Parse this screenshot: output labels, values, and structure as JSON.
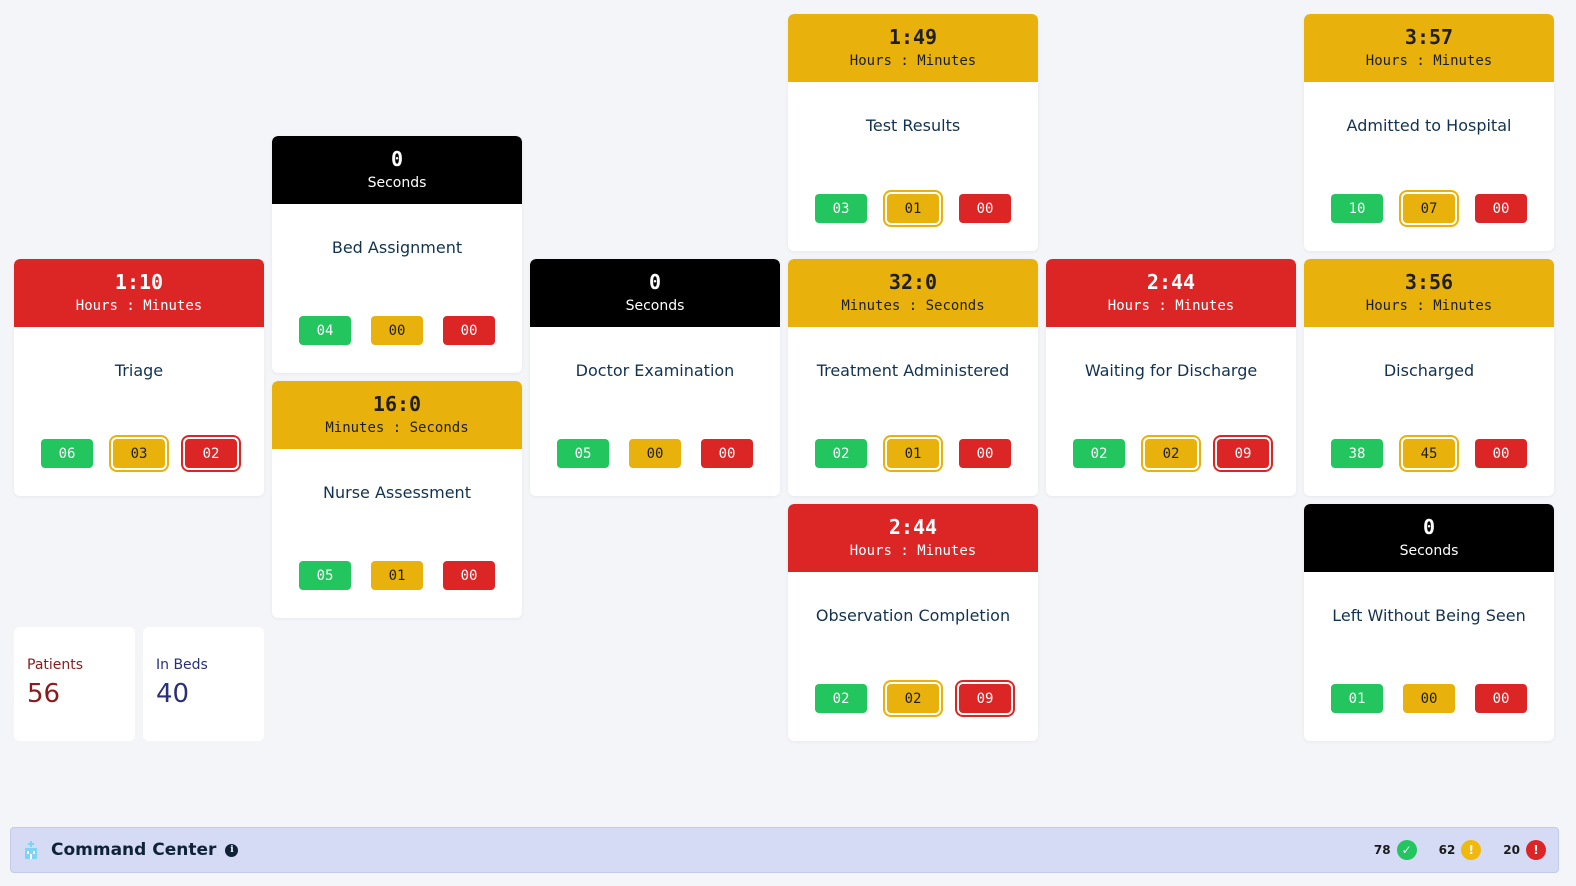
{
  "cards": [
    {
      "id": "triage",
      "title": "Triage",
      "timer": {
        "value": "1:10",
        "unit": "Hours : Minutes",
        "color": "red"
      },
      "badges": [
        {
          "value": "06",
          "color": "green"
        },
        {
          "value": "03",
          "color": "yellow",
          "ring": true
        },
        {
          "value": "02",
          "color": "red",
          "ring": true
        }
      ]
    },
    {
      "id": "bed-assignment",
      "title": "Bed Assignment",
      "timer": {
        "value": "0",
        "unit": "Seconds",
        "color": "black"
      },
      "badges": [
        {
          "value": "04",
          "color": "green"
        },
        {
          "value": "00",
          "color": "yellow"
        },
        {
          "value": "00",
          "color": "red"
        }
      ]
    },
    {
      "id": "nurse-assessment",
      "title": "Nurse Assessment",
      "timer": {
        "value": "16:0",
        "unit": "Minutes : Seconds",
        "color": "yellow"
      },
      "badges": [
        {
          "value": "05",
          "color": "green"
        },
        {
          "value": "01",
          "color": "yellow"
        },
        {
          "value": "00",
          "color": "red"
        }
      ]
    },
    {
      "id": "doctor-examination",
      "title": "Doctor Examination",
      "timer": {
        "value": "0",
        "unit": "Seconds",
        "color": "black"
      },
      "badges": [
        {
          "value": "05",
          "color": "green"
        },
        {
          "value": "00",
          "color": "yellow"
        },
        {
          "value": "00",
          "color": "red"
        }
      ]
    },
    {
      "id": "test-results",
      "title": "Test Results",
      "timer": {
        "value": "1:49",
        "unit": "Hours : Minutes",
        "color": "yellow"
      },
      "badges": [
        {
          "value": "03",
          "color": "green"
        },
        {
          "value": "01",
          "color": "yellow",
          "ring": true
        },
        {
          "value": "00",
          "color": "red"
        }
      ]
    },
    {
      "id": "treatment-administered",
      "title": "Treatment Administered",
      "timer": {
        "value": "32:0",
        "unit": "Minutes : Seconds",
        "color": "yellow"
      },
      "badges": [
        {
          "value": "02",
          "color": "green"
        },
        {
          "value": "01",
          "color": "yellow",
          "ring": true
        },
        {
          "value": "00",
          "color": "red"
        }
      ]
    },
    {
      "id": "observation-completion",
      "title": "Observation Completion",
      "timer": {
        "value": "2:44",
        "unit": "Hours : Minutes",
        "color": "red"
      },
      "badges": [
        {
          "value": "02",
          "color": "green"
        },
        {
          "value": "02",
          "color": "yellow",
          "ring": true
        },
        {
          "value": "09",
          "color": "red",
          "ring": true
        }
      ]
    },
    {
      "id": "waiting-for-discharge",
      "title": "Waiting for Discharge",
      "timer": {
        "value": "2:44",
        "unit": "Hours : Minutes",
        "color": "red"
      },
      "badges": [
        {
          "value": "02",
          "color": "green"
        },
        {
          "value": "02",
          "color": "yellow",
          "ring": true
        },
        {
          "value": "09",
          "color": "red",
          "ring": true
        }
      ]
    },
    {
      "id": "admitted-to-hospital",
      "title": "Admitted to Hospital",
      "timer": {
        "value": "3:57",
        "unit": "Hours : Minutes",
        "color": "yellow"
      },
      "badges": [
        {
          "value": "10",
          "color": "green"
        },
        {
          "value": "07",
          "color": "yellow",
          "ring": true
        },
        {
          "value": "00",
          "color": "red"
        }
      ]
    },
    {
      "id": "discharged",
      "title": "Discharged",
      "timer": {
        "value": "3:56",
        "unit": "Hours : Minutes",
        "color": "yellow"
      },
      "badges": [
        {
          "value": "38",
          "color": "green"
        },
        {
          "value": "45",
          "color": "yellow",
          "ring": true
        },
        {
          "value": "00",
          "color": "red"
        }
      ]
    },
    {
      "id": "left-without-being-seen",
      "title": "Left Without Being Seen",
      "timer": {
        "value": "0",
        "unit": "Seconds",
        "color": "black"
      },
      "badges": [
        {
          "value": "01",
          "color": "green"
        },
        {
          "value": "00",
          "color": "yellow"
        },
        {
          "value": "00",
          "color": "red"
        }
      ]
    }
  ],
  "stats": {
    "patients": {
      "label": "Patients",
      "value": "56"
    },
    "in_beds": {
      "label": "In Beds",
      "value": "40"
    }
  },
  "footer": {
    "title": "Command Center",
    "counters": [
      {
        "value": "78",
        "status": "green",
        "symbol": "✓"
      },
      {
        "value": "62",
        "status": "yellow",
        "symbol": "!"
      },
      {
        "value": "20",
        "status": "red",
        "symbol": "!"
      }
    ]
  },
  "colors": {
    "red": "#dc2626",
    "yellow": "#e8b10b",
    "green": "#22c55e",
    "black": "#000000",
    "footer_bg": "#d5dbf4"
  }
}
